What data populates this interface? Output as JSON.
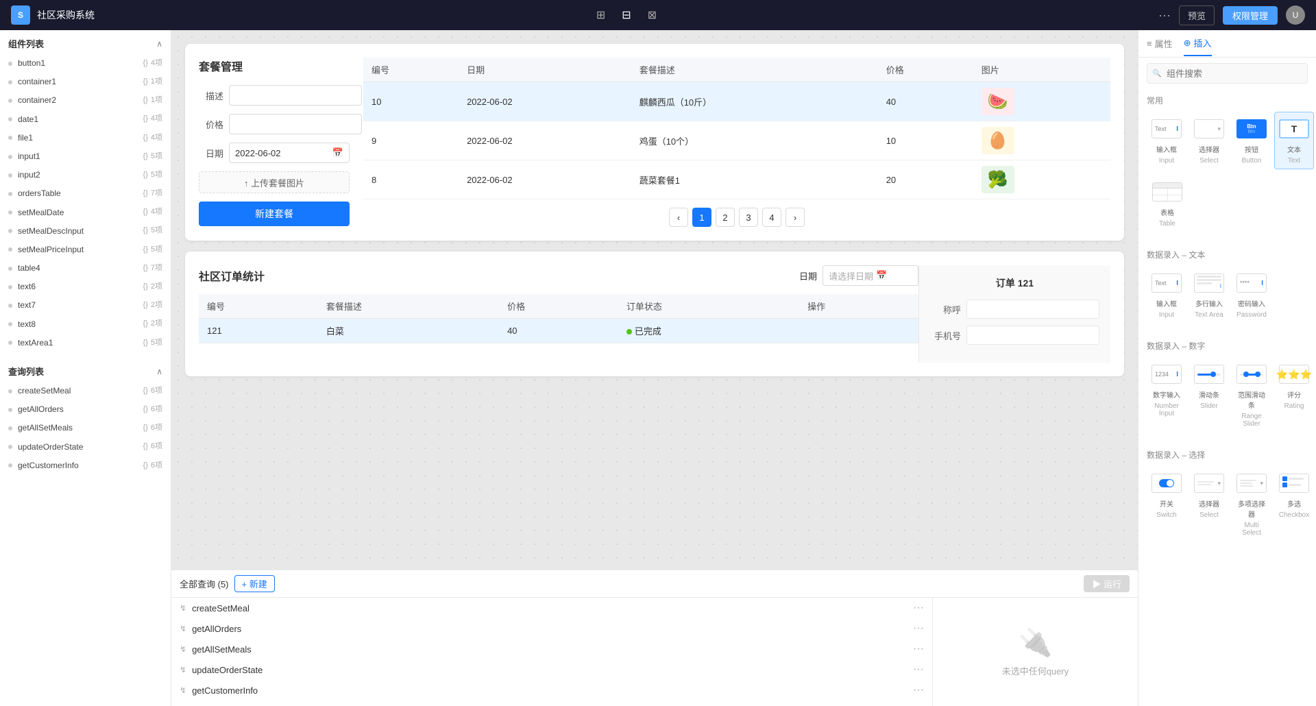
{
  "topbar": {
    "logo_text": "S",
    "app_name": "社区采购系统",
    "layout_icons": [
      "⊞",
      "⊟",
      "⊠"
    ],
    "dots": "···",
    "preview_label": "预览",
    "manage_label": "权限管理",
    "avatar_text": "U"
  },
  "left_sidebar": {
    "component_list_title": "组件列表",
    "collapse_icon": "∧",
    "components": [
      {
        "name": "button1",
        "type": "{}",
        "count": "4项"
      },
      {
        "name": "container1",
        "type": "{}",
        "count": "1项"
      },
      {
        "name": "container2",
        "type": "{}",
        "count": "1项"
      },
      {
        "name": "date1",
        "type": "{}",
        "count": "4项"
      },
      {
        "name": "file1",
        "type": "{}",
        "count": "4项"
      },
      {
        "name": "input1",
        "type": "{}",
        "count": "5项"
      },
      {
        "name": "input2",
        "type": "{}",
        "count": "5项"
      },
      {
        "name": "ordersTable",
        "type": "{}",
        "count": "7项"
      },
      {
        "name": "setMealDate",
        "type": "{}",
        "count": "4项"
      },
      {
        "name": "setMealDescInput",
        "type": "{}",
        "count": "5项"
      },
      {
        "name": "setMealPriceInput",
        "type": "{}",
        "count": "5项"
      },
      {
        "name": "table4",
        "type": "{}",
        "count": "7项"
      },
      {
        "name": "text6",
        "type": "{}",
        "count": "2项"
      },
      {
        "name": "text7",
        "type": "{}",
        "count": "2项"
      },
      {
        "name": "text8",
        "type": "{}",
        "count": "2项"
      },
      {
        "name": "textArea1",
        "type": "{}",
        "count": "5项"
      }
    ],
    "query_list_title": "查询列表",
    "queries": [
      {
        "name": "createSetMeal",
        "type": "{}",
        "count": "6项"
      },
      {
        "name": "getAllOrders",
        "type": "{}",
        "count": "6项"
      },
      {
        "name": "getAllSetMeals",
        "type": "{}",
        "count": "6项"
      },
      {
        "name": "updateOrderState",
        "type": "{}",
        "count": "6项"
      },
      {
        "name": "getCustomerInfo",
        "type": "{}",
        "count": "6项"
      }
    ]
  },
  "meal_management": {
    "title": "套餐管理",
    "form": {
      "desc_label": "描述",
      "price_label": "价格",
      "date_label": "日期",
      "date_value": "2022-06-02",
      "upload_label": "↑ 上传套餐图片",
      "create_label": "新建套餐"
    },
    "table": {
      "columns": [
        "编号",
        "日期",
        "套餐描述",
        "价格",
        "图片"
      ],
      "rows": [
        {
          "id": "10",
          "date": "2022-06-02",
          "desc": "麒麟西瓜（10斤）",
          "price": "40",
          "img": "🍉",
          "selected": true
        },
        {
          "id": "9",
          "date": "2022-06-02",
          "desc": "鸡蛋（10个）",
          "price": "10",
          "img": "🥚"
        },
        {
          "id": "8",
          "date": "2022-06-02",
          "desc": "蔬菜套餐1",
          "price": "20",
          "img": "🥦"
        }
      ],
      "pagination": [
        "1",
        "2",
        "3",
        "4"
      ]
    }
  },
  "order_stats": {
    "title": "社区订单统计",
    "date_placeholder": "请选择日期",
    "table": {
      "columns": [
        "编号",
        "套餐描述",
        "价格",
        "订单状态",
        "操作"
      ],
      "rows": [
        {
          "id": "121",
          "desc": "白菜",
          "price": "40",
          "status": "已完成",
          "status_color": "#52c41a"
        }
      ]
    }
  },
  "order_detail": {
    "title": "订单 121",
    "name_label": "称呼",
    "phone_label": "手机号"
  },
  "bottom_panel": {
    "query_count_label": "全部查询 (5)",
    "new_label": "+ 新建",
    "run_label": "▶ 运行",
    "run_disabled": true,
    "queries": [
      {
        "name": "createSetMeal",
        "more": "···"
      },
      {
        "name": "getAllOrders",
        "more": "···"
      },
      {
        "name": "getAllSetMeals",
        "more": "···"
      },
      {
        "name": "updateOrderState",
        "more": "···"
      },
      {
        "name": "getCustomerInfo",
        "more": "···"
      }
    ],
    "no_select_hint": "未选中任何query"
  },
  "right_panel": {
    "tab_property": "属性",
    "tab_insert": "插入",
    "tab_insert_icon": "⊕",
    "tab_property_icon": "≡",
    "search_placeholder": "组件搜索",
    "sections": {
      "common": {
        "title": "常用",
        "widgets": [
          {
            "name": "输入框",
            "sub": "Input",
            "type": "input"
          },
          {
            "name": "选择器",
            "sub": "Select",
            "type": "select"
          },
          {
            "name": "按钮",
            "sub": "Button",
            "type": "button"
          },
          {
            "name": "文本",
            "sub": "Text",
            "type": "text",
            "selected": true
          }
        ]
      },
      "table": {
        "widgets": [
          {
            "name": "表格",
            "sub": "Table",
            "type": "table"
          }
        ]
      },
      "data_text": {
        "title": "数据录入 – 文本",
        "widgets": [
          {
            "name": "输入框",
            "sub": "Input",
            "type": "input2"
          },
          {
            "name": "多行输入",
            "sub": "Text Area",
            "type": "textarea"
          },
          {
            "name": "密码输入",
            "sub": "Password",
            "type": "password"
          }
        ]
      },
      "data_number": {
        "title": "数据录入 – 数字",
        "widgets": [
          {
            "name": "数字输入",
            "sub": "Number Input",
            "type": "number"
          },
          {
            "name": "滑动条",
            "sub": "Slider",
            "type": "slider"
          },
          {
            "name": "范围滑动条",
            "sub": "Range Slider",
            "type": "rangeslider"
          },
          {
            "name": "评分",
            "sub": "Rating",
            "type": "rating"
          }
        ]
      },
      "data_select": {
        "title": "数据录入 – 选择",
        "widgets": [
          {
            "name": "开关",
            "sub": "Switch",
            "type": "switch"
          },
          {
            "name": "选择器",
            "sub": "Select",
            "type": "select2"
          },
          {
            "name": "多项选择器",
            "sub": "Multi Select",
            "type": "multiselect"
          },
          {
            "name": "多选",
            "sub": "Checkbox",
            "type": "checkbox"
          }
        ]
      }
    }
  }
}
